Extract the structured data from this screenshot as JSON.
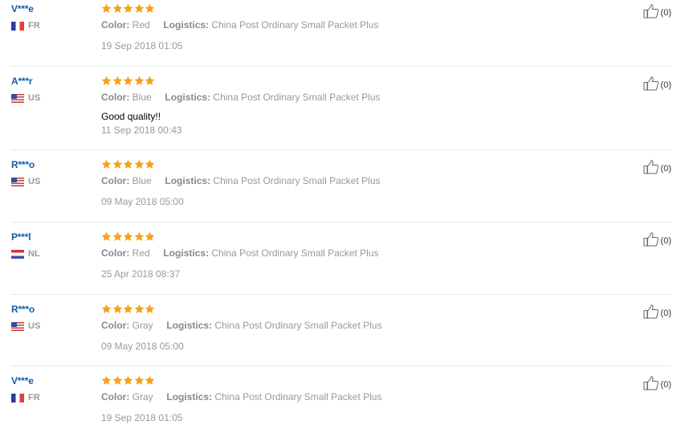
{
  "labels": {
    "color": "Color:",
    "logistics": "Logistics:"
  },
  "colors": {
    "name": "#0f5ea8",
    "star": "#f4a21b",
    "divider": "#e8e8e8"
  },
  "reviews": [
    {
      "user": "V***e",
      "country": "FR",
      "flag": "flag-fr",
      "rating": 5,
      "color": "Red",
      "logistics": "China Post Ordinary Small Packet Plus",
      "text": "",
      "date": "19 Sep 2018 01:05",
      "helpful": "(0)"
    },
    {
      "user": "A***r",
      "country": "US",
      "flag": "flag-us",
      "rating": 5,
      "color": "Blue",
      "logistics": "China Post Ordinary Small Packet Plus",
      "text": "Good quality!!",
      "date": "11 Sep 2018 00:43",
      "helpful": "(0)"
    },
    {
      "user": "R***o",
      "country": "US",
      "flag": "flag-us",
      "rating": 5,
      "color": "Blue",
      "logistics": "China Post Ordinary Small Packet Plus",
      "text": "",
      "date": "09 May 2018 05:00",
      "helpful": "(0)"
    },
    {
      "user": "P***l",
      "country": "NL",
      "flag": "flag-nl",
      "rating": 5,
      "color": "Red",
      "logistics": "China Post Ordinary Small Packet Plus",
      "text": "",
      "date": "25 Apr 2018 08:37",
      "helpful": "(0)"
    },
    {
      "user": "R***o",
      "country": "US",
      "flag": "flag-us",
      "rating": 5,
      "color": "Gray",
      "logistics": "China Post Ordinary Small Packet Plus",
      "text": "",
      "date": "09 May 2018 05:00",
      "helpful": "(0)"
    },
    {
      "user": "V***e",
      "country": "FR",
      "flag": "flag-fr",
      "rating": 5,
      "color": "Gray",
      "logistics": "China Post Ordinary Small Packet Plus",
      "text": "",
      "date": "19 Sep 2018 01:05",
      "helpful": "(0)"
    }
  ]
}
